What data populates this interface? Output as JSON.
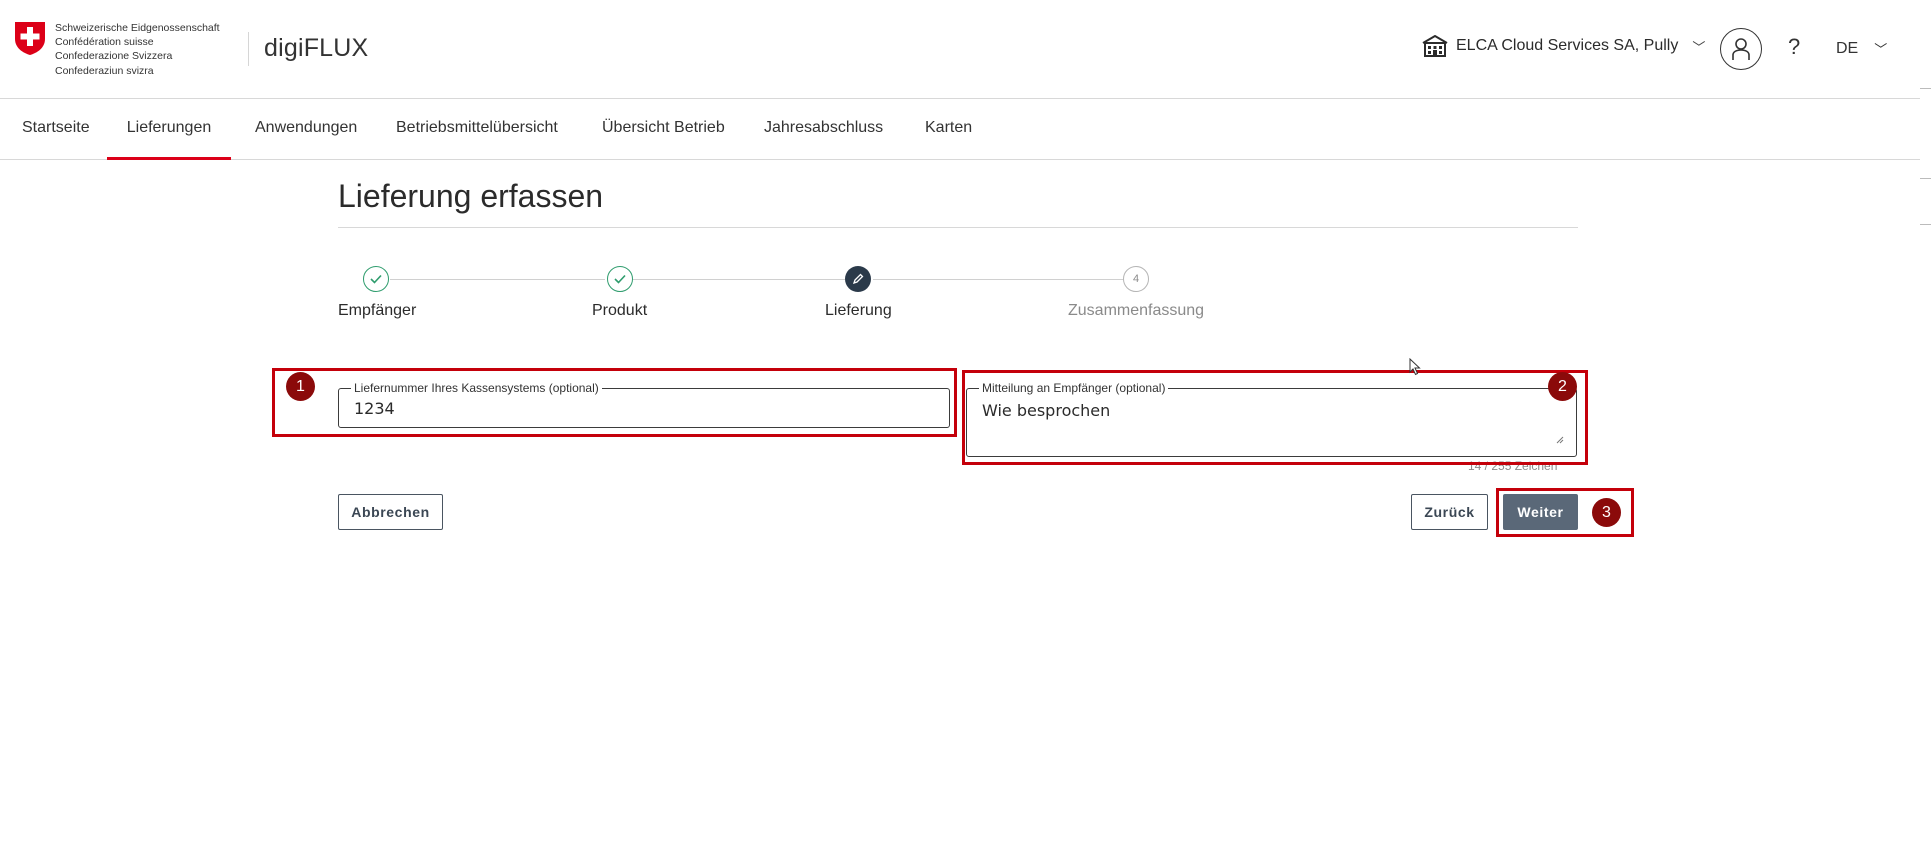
{
  "header": {
    "confederation_lines": [
      "Schweizerische Eidgenossenschaft",
      "Confédération suisse",
      "Confederazione Svizzera",
      "Confederaziun svizra"
    ],
    "app_name": "digiFLUX",
    "organization": "ELCA Cloud Services SA, Pully",
    "help": "?",
    "language": "DE"
  },
  "nav": {
    "items": [
      "Startseite",
      "Lieferungen",
      "Anwendungen",
      "Betriebsmittelübersicht",
      "Übersicht Betrieb",
      "Jahresabschluss",
      "Karten"
    ],
    "active": "Lieferungen"
  },
  "page": {
    "title": "Lieferung erfassen"
  },
  "stepper": {
    "steps": [
      {
        "label": "Empfänger",
        "state": "done"
      },
      {
        "label": "Produkt",
        "state": "done"
      },
      {
        "label": "Lieferung",
        "state": "current"
      },
      {
        "label": "Zusammenfassung",
        "state": "todo",
        "number": "4"
      }
    ]
  },
  "form": {
    "delivery_number": {
      "label": "Liefernummer Ihres Kassensystems (optional)",
      "value": "1234"
    },
    "message": {
      "label": "Mitteilung an Empfänger (optional)",
      "value": "Wie besprochen",
      "counter": "14 / 255 Zeichen"
    }
  },
  "buttons": {
    "cancel": "Abbrechen",
    "back": "Zurück",
    "next": "Weiter"
  },
  "annotations": [
    "1",
    "2",
    "3"
  ],
  "colors": {
    "swiss_red": "#dc0018",
    "annotation_red": "#c4000a",
    "badge_red": "#8b0a0a",
    "step_done": "#2e9c6d",
    "step_current": "#2b3a4a",
    "primary_button": "#5a6878"
  }
}
